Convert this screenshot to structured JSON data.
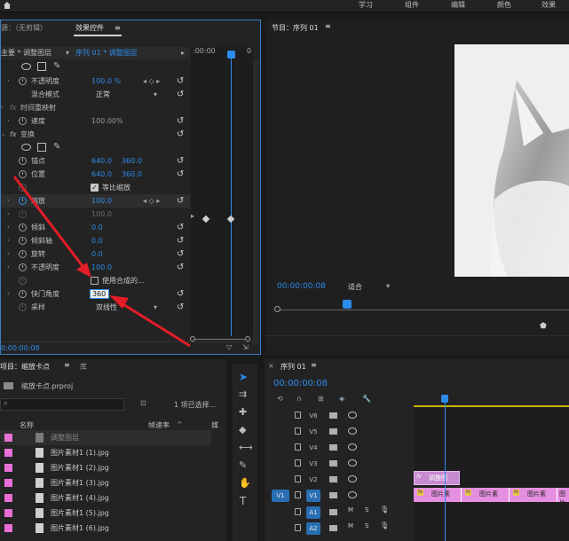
{
  "menu": {
    "items": [
      "学习",
      "组件",
      "编辑",
      "颜色",
      "效果"
    ]
  },
  "effect_controls": {
    "tab_source": "源：（无剪辑）",
    "tab_title": "效果控件",
    "master_label": "主要 * 调整图层",
    "sequence_label": "序列 01 * 调整图层",
    "timecode_start": ":00:00",
    "timecode_end": "0",
    "opacity": {
      "name": "不透明度",
      "value": "100.0 %"
    },
    "blend": {
      "name": "混合模式",
      "value": "正常"
    },
    "time_remap": "时间重映射",
    "speed": {
      "name": "速度",
      "value": "100.00%"
    },
    "transform": "变换",
    "anchor": {
      "name": "锚点",
      "x": "640.0",
      "y": "360.0"
    },
    "position": {
      "name": "位置",
      "x": "640.0",
      "y": "360.0"
    },
    "uniform_scale": "等比缩放",
    "scale": {
      "name": "缩放",
      "value": "100.0"
    },
    "scale_width": {
      "value": "100.0"
    },
    "skew": {
      "name": "倾斜",
      "value": "0.0"
    },
    "skew_axis": {
      "name": "倾斜轴",
      "value": "0.0"
    },
    "rotation": {
      "name": "旋转",
      "value": "0.0"
    },
    "opacity2": {
      "name": "不透明度",
      "value": "100.0"
    },
    "use_comp": "使用合成的...",
    "shutter": {
      "name": "快门角度",
      "value": "360"
    },
    "sampling": {
      "name": "采样",
      "value": "双线性"
    },
    "bottom_timecode": "0:00:00:08"
  },
  "program": {
    "title": "节目：序列 01",
    "timecode": "00:00:00:08",
    "fit": "适合"
  },
  "project": {
    "tab": "项目：缩放卡点",
    "tab2": "库",
    "file": "缩放卡点.prproj",
    "selection": "1 项已选择...",
    "col_name": "名称",
    "col_rate": "帧速率",
    "col_media": "媒",
    "items": [
      "调整图层",
      "图片素材1 (1).jpg",
      "图片素材1 (2).jpg",
      "图片素材1 (3).jpg",
      "图片素材1 (4).jpg",
      "图片素材1 (5).jpg",
      "图片素材1 (6).jpg"
    ]
  },
  "timeline": {
    "title": "序列 01",
    "timecode": "00:00:00:08",
    "video_tracks": [
      "V6",
      "V5",
      "V4",
      "V3",
      "V2",
      "V1"
    ],
    "audio_tracks": [
      "A1",
      "A2"
    ],
    "source_v1": "V1",
    "adj_clip": "调整图",
    "clips": [
      "图片素",
      "图片素",
      "图片素",
      "图片素材"
    ],
    "track_m": "M",
    "track_s": "S"
  },
  "colors": {
    "accent": "#2d8ceb",
    "clip_pink": "#e58fe0",
    "panel": "#232323"
  }
}
